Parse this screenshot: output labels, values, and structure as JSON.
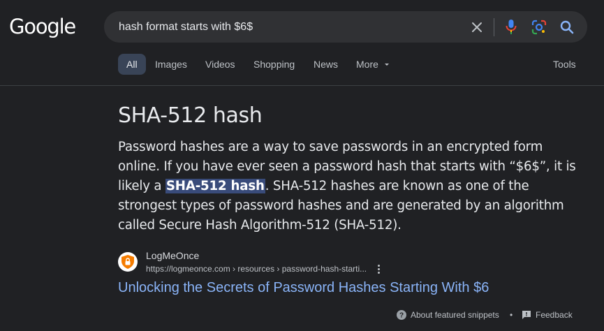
{
  "logo": {
    "text": "Google"
  },
  "search": {
    "query": "hash format starts with $6$"
  },
  "icons": {
    "clear": "close-icon",
    "voice": "microphone-icon",
    "lens": "camera-lens-icon",
    "search": "search-icon"
  },
  "tabs": [
    {
      "label": "All",
      "active": true
    },
    {
      "label": "Images"
    },
    {
      "label": "Videos"
    },
    {
      "label": "Shopping"
    },
    {
      "label": "News"
    },
    {
      "label": "More"
    }
  ],
  "tools_label": "Tools",
  "snippet": {
    "title": "SHA-512 hash",
    "body_before": "Password hashes are a way to save passwords in an encrypted form online. If you have ever seen a password hash that starts with “$6$”, it is likely a ",
    "highlight": "SHA-512 hash",
    "body_after": ". SHA-512 hashes are known as one of the strongest types of password hashes and are generated by an algorithm called Secure Hash Algorithm-512 (SHA-512)."
  },
  "source": {
    "name": "LogMeOnce",
    "url": "https://logmeonce.com › resources › password-hash-starti...",
    "link_title": "Unlocking the Secrets of Password Hashes Starting With $6"
  },
  "footer": {
    "about": "About featured snippets",
    "separator": "•",
    "feedback": "Feedback"
  },
  "colors": {
    "background": "#202124",
    "link": "#8ab4f8",
    "highlight": "#394b7a",
    "mic_blue": "#4285f4",
    "mic_red": "#ea4335",
    "mic_yellow": "#fbbc04",
    "mic_green": "#34a853",
    "favicon_orange": "#f57c00"
  }
}
